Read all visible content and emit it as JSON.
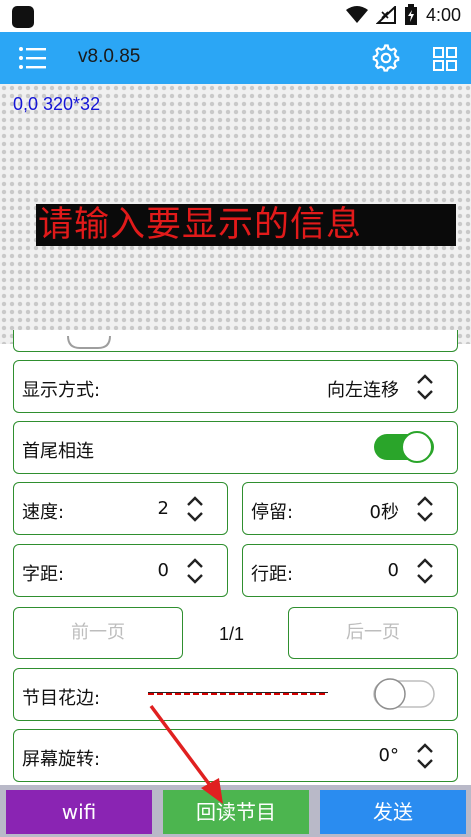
{
  "status_bar": {
    "time": "4:00"
  },
  "app_bar": {
    "title": "v8.0.85"
  },
  "preview": {
    "info": "0,0 320*32",
    "led_text": "请输入要显示的信息",
    "led_text_color": "#e11a1a"
  },
  "settings": {
    "display_mode": {
      "label": "显示方式:",
      "value": "向左连移"
    },
    "head_tail": {
      "label": "首尾相连",
      "on": true
    },
    "speed": {
      "label": "速度:",
      "value": "2"
    },
    "stay": {
      "label": "停留:",
      "value": "0秒"
    },
    "char_spacing": {
      "label": "字距:",
      "value": "0"
    },
    "line_spacing": {
      "label": "行距:",
      "value": "0"
    },
    "border": {
      "label": "节目花边:",
      "on": false
    },
    "rotation": {
      "label": "屏幕旋转:",
      "value": "0°"
    }
  },
  "pager": {
    "prev": "前一页",
    "count": "1/1",
    "next": "后一页"
  },
  "bottom_bar": {
    "wifi": "wifi",
    "readback": "回读节目",
    "send": "发送"
  },
  "colors": {
    "accent": "#2ba6f5",
    "border": "#2f8f2f",
    "toggle_on": "#2aa52a"
  }
}
